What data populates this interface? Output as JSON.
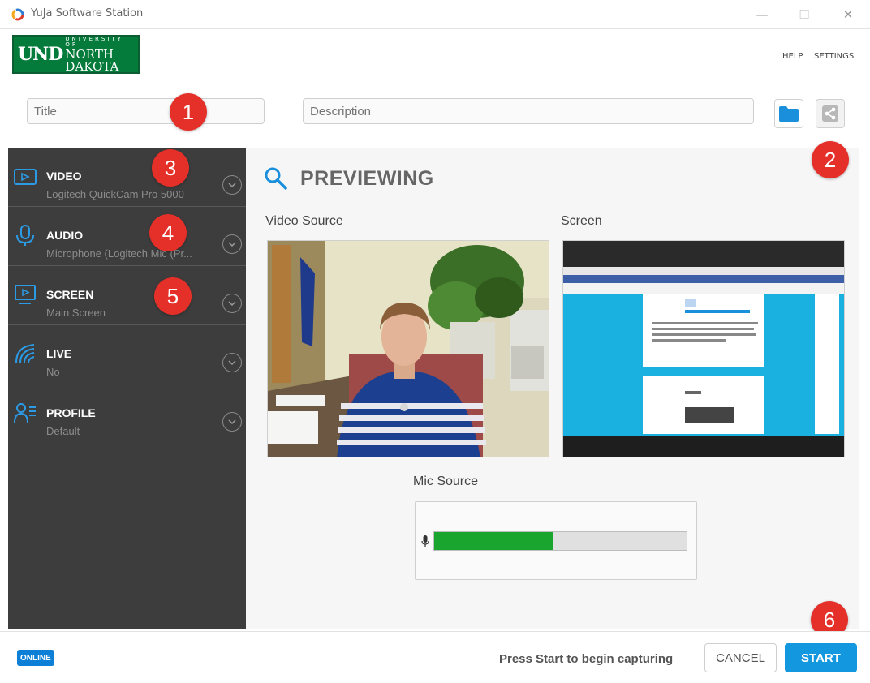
{
  "window": {
    "title": "YuJa Software Station",
    "minimize_glyph": "—",
    "maximize_glyph": "☐",
    "close_glyph": "✕"
  },
  "header": {
    "logo": {
      "short": "UND",
      "univ": "UNIVERSITY OF",
      "name": "NORTH DAKOTA"
    },
    "help_label": "HELP",
    "settings_label": "SETTINGS"
  },
  "form": {
    "title_placeholder": "Title",
    "description_placeholder": "Description",
    "title_value": "",
    "description_value": ""
  },
  "toolbar_icons": [
    "folder-icon",
    "share-icon"
  ],
  "badges": [
    "1",
    "2",
    "3",
    "4",
    "5",
    "6"
  ],
  "sidebar": {
    "items": [
      {
        "label": "VIDEO",
        "sub": "Logitech QuickCam Pro 5000",
        "icon": "video-camera-icon"
      },
      {
        "label": "AUDIO",
        "sub": "Microphone (Logitech Mic (Pr...",
        "icon": "microphone-icon"
      },
      {
        "label": "SCREEN",
        "sub": "Main Screen",
        "icon": "screen-icon"
      },
      {
        "label": "LIVE",
        "sub": "No",
        "icon": "live-signal-icon"
      },
      {
        "label": "PROFILE",
        "sub": "Default",
        "icon": "profile-icon"
      }
    ]
  },
  "preview": {
    "heading": "PREVIEWING",
    "video_source_label": "Video Source",
    "screen_label": "Screen",
    "mic_source_label": "Mic Source",
    "mic_level": 0.47
  },
  "footer": {
    "status_badge": "ONLINE",
    "status_text": "Press Start to begin capturing",
    "cancel_label": "CANCEL",
    "start_label": "START"
  },
  "colors": {
    "sidebar_bg": "#3d3d3d",
    "accent": "#1398e0",
    "badge": "#e5302a",
    "brand_green": "#047a3b",
    "meter_fill": "#19a52e"
  }
}
